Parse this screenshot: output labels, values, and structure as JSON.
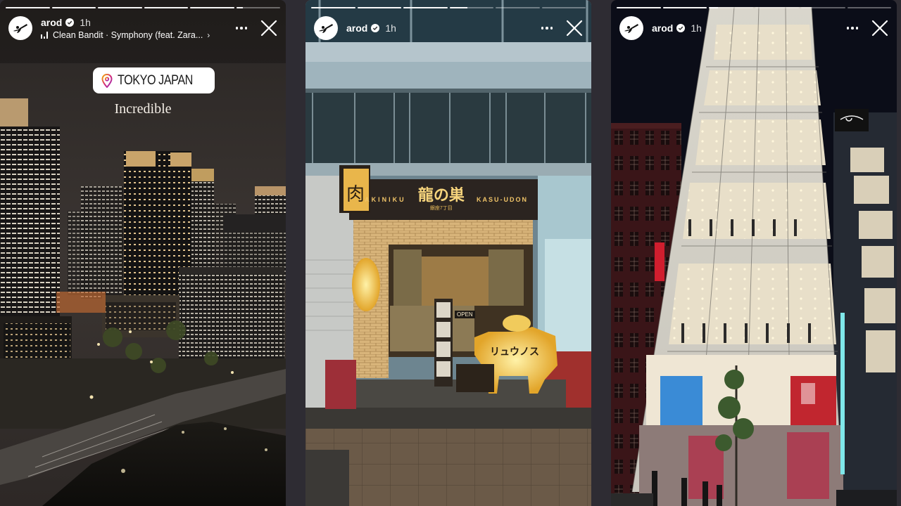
{
  "colors": {
    "gap_background": "#2e2c33",
    "overlay_text": "#ffffff",
    "sticker_background": "#ffffff",
    "sticker_text": "#1a1a1a",
    "location_pin_gradient": [
      "#f5b400",
      "#d62976",
      "#962fbf"
    ]
  },
  "stories": [
    {
      "progress": {
        "segments": 6,
        "completed": 5,
        "current_fraction": 0.15
      },
      "header": {
        "avatar_icon": "martial-arts-kick-logo",
        "username": "arod",
        "verified": true,
        "time": "1h",
        "music": {
          "icon": "equalizer-icon",
          "text": "Clean Bandit · Symphony (feat. Zara...",
          "chevron": "›"
        }
      },
      "stickers": {
        "location": {
          "icon": "location-pin-icon",
          "text": "TOKYO JAPAN"
        },
        "caption": "Incredible"
      },
      "scene": "Night skyline of Tokyo Marunouchi skyscrapers above a moat and plaza"
    },
    {
      "progress": {
        "segments": 6,
        "completed": 3,
        "current_fraction": 0.4
      },
      "header": {
        "avatar_icon": "martial-arts-kick-logo",
        "username": "arod",
        "verified": true,
        "time": "1h"
      },
      "scene": "Yakiniku restaurant storefront with illuminated sign",
      "signage": {
        "left": "YAKINIKU",
        "center": "龍の巣",
        "sub": "銀座7丁目",
        "right": "KASU-UDON",
        "side_box": "肉",
        "open_sign": "OPEN",
        "cow_sign": "リュウノス"
      }
    },
    {
      "progress": {
        "segments": 6,
        "completed": 2,
        "current_fraction": 0.2
      },
      "header": {
        "avatar_icon": "martial-arts-kick-logo",
        "username": "arod",
        "verified": true,
        "time": "1h"
      },
      "scene": "Glass-fronted multi-story retail building at night on Ginza street with tree"
    }
  ]
}
